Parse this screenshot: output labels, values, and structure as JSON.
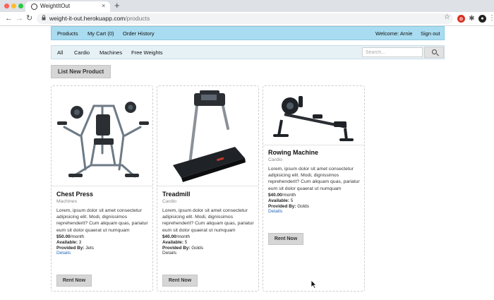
{
  "browser": {
    "tab_title": "WeightItOut",
    "tab_close": "×",
    "new_tab": "+",
    "back": "←",
    "forward": "→",
    "reload": "↻",
    "url_host": "weight-it-out.herokuapp.com",
    "url_path": "/products",
    "lock": "🔒",
    "star": "☆",
    "ext_red": "o",
    "ext_puzzle": "✱",
    "ext_avatar": "●",
    "menu": "⋮"
  },
  "site_nav": {
    "left": [
      "Products",
      "My Cart (0)",
      "Order History"
    ],
    "welcome": "Welcome: Arnie",
    "sign_out": "Sign out"
  },
  "categories": {
    "items": [
      "All",
      "Cardio",
      "Machines",
      "Free Weights"
    ],
    "search_placeholder": "Search..."
  },
  "list_new_product": "List New Product",
  "labels": {
    "available": "Available:",
    "provided_by": "Provided By:",
    "details": "Details",
    "rent_now": "Rent Now"
  },
  "products": [
    {
      "name": "Chest Press",
      "category": "Machines",
      "description": "Lorem, ipsum dolor sit amet consectetur adipisicing elit. Modi, dignissimos reprehenderit? Cum aliquam quas, pariatur eum sit dolor quaerat ut numquam",
      "price": "$50.00",
      "period": "/month",
      "available": "3",
      "provider": "Jets"
    },
    {
      "name": "Treadmill",
      "category": "Cardio",
      "description": "Lorem, ipsum dolor sit amet consectetur adipisicing elit. Modi, dignissimos reprehenderit? Cum aliquam quas, pariatur eum sit dolor quaerat ut numquam",
      "price": "$40.00",
      "period": "/month",
      "available": "5",
      "provider": "Golds"
    },
    {
      "name": "Rowing Machine",
      "category": "Cardio",
      "description": "Lorem, ipsum dolor sit amet consectetur adipisicing elit. Modi, dignissimos reprehenderit? Cum aliquam quas, pariatur eum sit dolor quaerat ut numquam",
      "price": "$40.00",
      "period": "/month",
      "available": "5",
      "provider": "Golds"
    }
  ],
  "colors": {
    "nav_bg": "#a9dcf0",
    "category_bg": "#e6f1f6",
    "link": "#2468b4",
    "button_bg": "#d6d6d6"
  },
  "icons": [
    "search-icon",
    "lock-icon",
    "star-icon",
    "cursor-icon"
  ]
}
